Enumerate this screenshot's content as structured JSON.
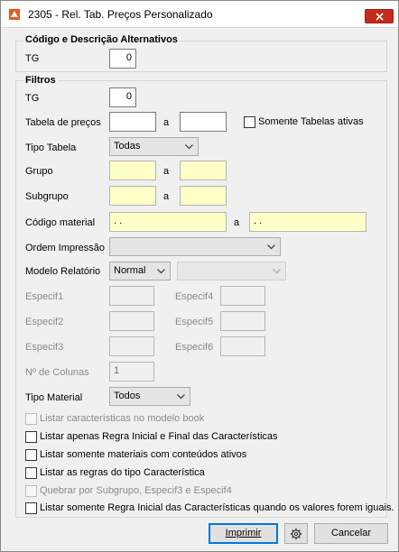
{
  "window": {
    "title": "2305 - Rel. Tab. Preços Personalizado"
  },
  "alt_section": {
    "title": "Código e Descrição Alternativos",
    "tg_label": "TG",
    "tg_value": "0"
  },
  "filtros": {
    "title": "Filtros",
    "tg_label": "TG",
    "tg_value": "0",
    "tabela_label": "Tabela de preços",
    "tabela_from": "",
    "tabela_to": "",
    "a_label": "a",
    "somente_ativas_label": "Somente Tabelas ativas",
    "tipo_tabela_label": "Tipo Tabela",
    "tipo_tabela_value": "Todas",
    "grupo_label": "Grupo",
    "grupo_from": "",
    "grupo_to": "",
    "subgrupo_label": "Subgrupo",
    "subgrupo_from": "",
    "subgrupo_to": "",
    "codigo_material_label": "Código material",
    "codigo_from": " .  .",
    "codigo_to": " .  .",
    "ordem_label": "Ordem Impressão",
    "ordem_value": "",
    "modelo_label": "Modelo Relatório",
    "modelo_value": "Normal",
    "modelo_extra_value": "",
    "especif1_label": "Especif1",
    "especif2_label": "Especif2",
    "especif3_label": "Especif3",
    "especif4_label": "Especif4",
    "especif5_label": "Especif5",
    "especif6_label": "Especif6",
    "colunas_label": "Nº de Colunas",
    "colunas_value": "1",
    "tipo_material_label": "Tipo Material",
    "tipo_material_value": "Todos",
    "checkboxes": [
      {
        "label": "Listar características no modelo book",
        "enabled": false
      },
      {
        "label": "Listar apenas Regra Inicial e Final das Características",
        "enabled": true
      },
      {
        "label": "Listar somente materiais com conteúdos ativos",
        "enabled": true
      },
      {
        "label": "Listar as regras do tipo Característica",
        "enabled": true
      },
      {
        "label": "Quebrar por Subgrupo, Especif3 e Especif4",
        "enabled": false
      },
      {
        "label": "Listar somente Regra Inicial das Características quando os valores forem iguais.",
        "enabled": true
      }
    ]
  },
  "buttons": {
    "imprimir_label": "Imprimir",
    "cancelar_label": "Cancelar"
  },
  "icons": {
    "app": "app-icon",
    "close": "close-icon",
    "chevron": "chevron-down-icon",
    "gear": "gear-icon"
  }
}
